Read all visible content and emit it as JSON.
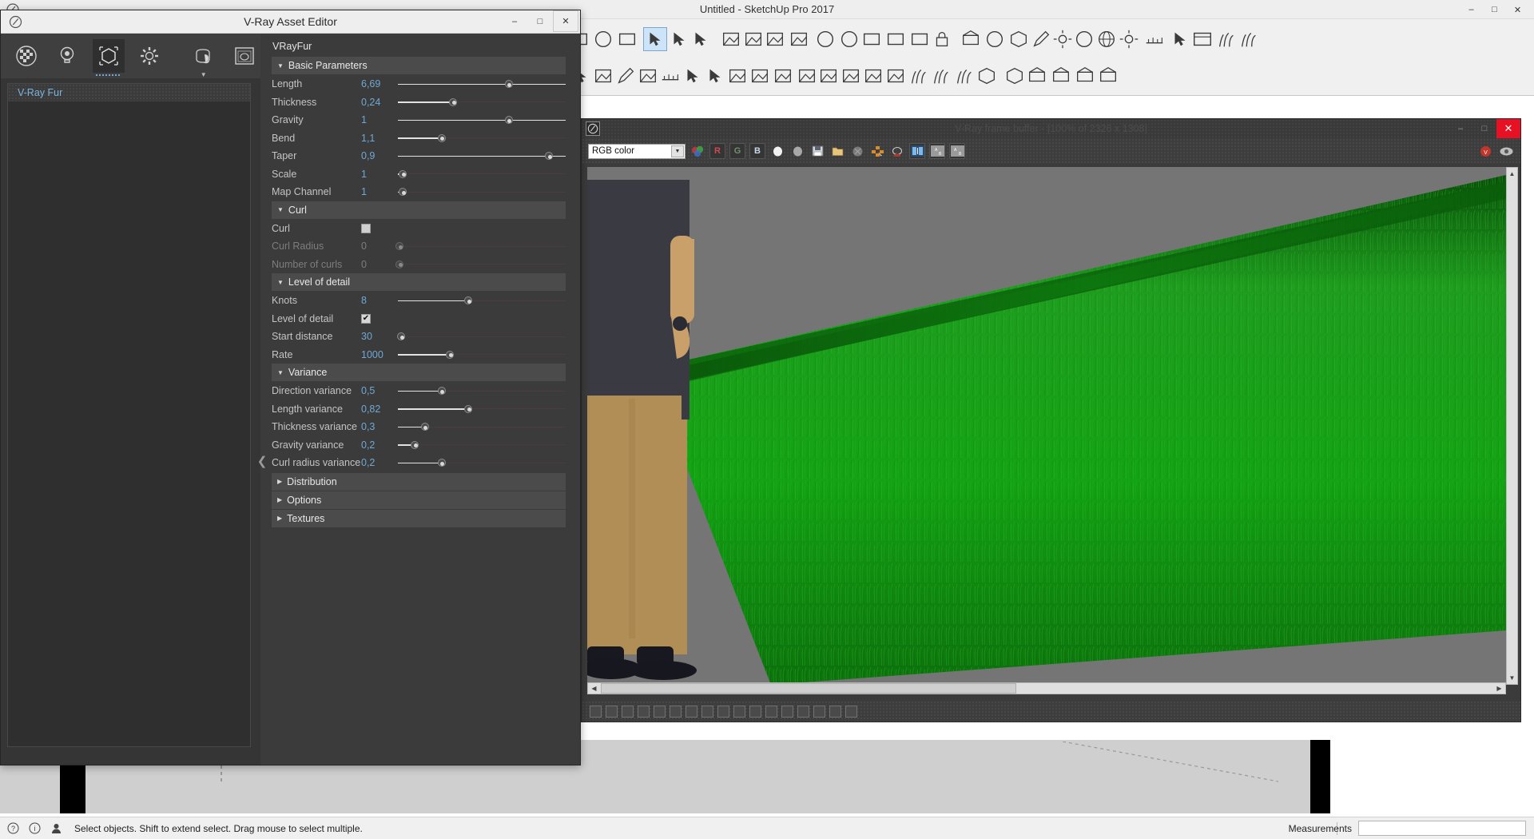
{
  "sketchup": {
    "window_title": "Untitled - SketchUp Pro 2017",
    "window_buttons": [
      "–",
      "□",
      "✕"
    ],
    "status_text": "Select objects. Shift to extend select. Drag mouse to select multiple.",
    "measurements_label": "Measurements",
    "measurements_value": "",
    "status_icons": [
      "help-icon",
      "info-icon",
      "person-icon"
    ]
  },
  "frame_buffer": {
    "title": "V-Ray frame buffer - [100% of 2326 x 1308]",
    "window_buttons": [
      "–",
      "□",
      "✕"
    ],
    "channel_select": "RGB color",
    "tools": [
      {
        "name": "color-channels-icon",
        "label": ""
      },
      {
        "name": "red-channel-icon",
        "label": "R"
      },
      {
        "name": "green-channel-icon",
        "label": "G"
      },
      {
        "name": "blue-channel-icon",
        "label": "B"
      },
      {
        "name": "alpha-white-icon",
        "label": ""
      },
      {
        "name": "alpha-grey-icon",
        "label": ""
      },
      {
        "name": "save-image-icon",
        "label": ""
      },
      {
        "name": "open-image-icon",
        "label": ""
      },
      {
        "name": "clear-image-icon",
        "label": ""
      },
      {
        "name": "region-render-icon",
        "label": ""
      },
      {
        "name": "render-teapot-icon",
        "label": ""
      },
      {
        "name": "ab-compare-icon",
        "label": ""
      },
      {
        "name": "ab-horizontal-icon",
        "label": ""
      },
      {
        "name": "ab-vertical-icon",
        "label": ""
      }
    ],
    "right_tools": [
      {
        "name": "vray-badge-icon"
      },
      {
        "name": "lens-effects-icon"
      }
    ],
    "status_icons": [
      "histogram-icon",
      "info-icon",
      "exposure-icon",
      "color-corrections-icon",
      "white-balance-icon",
      "hue-saturation-icon",
      "color-balance-icon",
      "levels-icon",
      "curve-icon",
      "lut-icon",
      "ocio-icon",
      "bloom-icon",
      "glare-icon",
      "lens-effects-icon",
      "background-icon",
      "stamp-icon",
      "denoise-icon"
    ]
  },
  "asset_editor": {
    "title": "V-Ray Asset Editor",
    "window_buttons": [
      "–",
      "□",
      "✕"
    ],
    "tabs": [
      {
        "name": "materials",
        "icon": "checker-sphere-icon",
        "active": false
      },
      {
        "name": "lights",
        "icon": "light-bulb-icon",
        "active": false
      },
      {
        "name": "geometry",
        "icon": "geometry-cube-icon",
        "active": true
      },
      {
        "name": "settings",
        "icon": "gear-icon",
        "active": false
      },
      {
        "name": "add-asset",
        "icon": "teapot-hand-icon",
        "active": false
      },
      {
        "name": "render",
        "icon": "render-window-icon",
        "active": false
      }
    ],
    "asset_list": [
      {
        "label": "V-Ray Fur",
        "selected": true
      }
    ],
    "selected_asset_name": "VRayFur",
    "sections": [
      {
        "id": "basic",
        "title": "Basic Parameters",
        "expanded": true,
        "rows": [
          {
            "label": "Length",
            "value": "6,69",
            "type": "slider",
            "fill": 1.0,
            "knob": 0.66,
            "disabled": false
          },
          {
            "label": "Thickness",
            "value": "0,24",
            "type": "slider",
            "fill": 0.33,
            "knob": 0.33,
            "disabled": false
          },
          {
            "label": "Gravity",
            "value": "1",
            "type": "slider",
            "fill": 1.0,
            "knob": 0.66,
            "disabled": false
          },
          {
            "label": "Bend",
            "value": "1,1",
            "type": "slider",
            "fill": 0.26,
            "knob": 0.26,
            "disabled": false
          },
          {
            "label": "Taper",
            "value": "0,9",
            "type": "slider",
            "fill": 1.0,
            "knob": 0.9,
            "disabled": false
          },
          {
            "label": "Scale",
            "value": "1",
            "type": "slider",
            "fill": 0.03,
            "knob": 0.03,
            "disabled": false
          },
          {
            "label": "Map Channel",
            "value": "1",
            "type": "slider",
            "fill": 0.03,
            "knob": 0.03,
            "disabled": false
          }
        ]
      },
      {
        "id": "curl",
        "title": "Curl",
        "expanded": true,
        "rows": [
          {
            "label": "Curl",
            "value": "",
            "type": "checkbox",
            "checked": false,
            "disabled": false
          },
          {
            "label": "Curl Radius",
            "value": "0",
            "type": "slider",
            "fill": 0.0,
            "knob": 0.01,
            "disabled": true
          },
          {
            "label": "Number of curls",
            "value": "0",
            "type": "slider",
            "fill": 0.0,
            "knob": 0.01,
            "disabled": true
          }
        ]
      },
      {
        "id": "lod",
        "title": "Level of detail",
        "expanded": true,
        "rows": [
          {
            "label": "Knots",
            "value": "8",
            "type": "slider",
            "fill": 0.42,
            "knob": 0.42,
            "disabled": false
          },
          {
            "label": "Level of detail",
            "value": "",
            "type": "checkbox",
            "checked": true,
            "disabled": false
          },
          {
            "label": "Start distance",
            "value": "30",
            "type": "slider",
            "fill": 0.02,
            "knob": 0.02,
            "disabled": false
          },
          {
            "label": "Rate",
            "value": "1000",
            "type": "slider",
            "fill": 0.31,
            "knob": 0.31,
            "disabled": false
          }
        ]
      },
      {
        "id": "variance",
        "title": "Variance",
        "expanded": true,
        "rows": [
          {
            "label": "Direction variance",
            "value": "0,5",
            "type": "slider",
            "fill": 0.26,
            "knob": 0.26,
            "disabled": false
          },
          {
            "label": "Length variance",
            "value": "0,82",
            "type": "slider",
            "fill": 0.42,
            "knob": 0.42,
            "disabled": false
          },
          {
            "label": "Thickness variance",
            "value": "0,3",
            "type": "slider",
            "fill": 0.16,
            "knob": 0.16,
            "disabled": false
          },
          {
            "label": "Gravity variance",
            "value": "0,2",
            "type": "slider",
            "fill": 0.1,
            "knob": 0.1,
            "disabled": false
          },
          {
            "label": "Curl radius variance",
            "value": "0,2",
            "type": "slider",
            "fill": 0.26,
            "knob": 0.26,
            "disabled": false
          }
        ]
      },
      {
        "id": "distribution",
        "title": "Distribution",
        "expanded": false,
        "rows": []
      },
      {
        "id": "options",
        "title": "Options",
        "expanded": false,
        "rows": []
      },
      {
        "id": "textures",
        "title": "Textures",
        "expanded": false,
        "rows": []
      }
    ]
  },
  "colors": {
    "panel_bg": "#3b3b3b",
    "section_header": "#4b4b4b",
    "value_blue": "#6fa8d4",
    "label_grey": "#c4c4c4",
    "accent_close": "#e81123",
    "grass_green": "#1d9b1d"
  }
}
